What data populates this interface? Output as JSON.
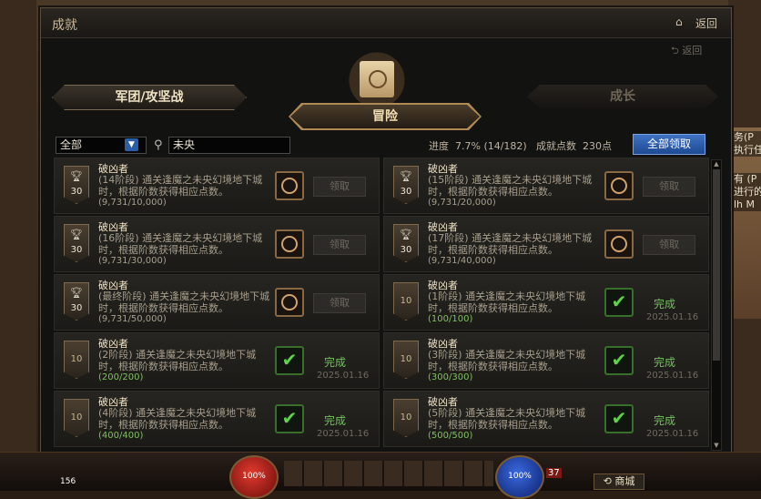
{
  "window": {
    "title": "成就",
    "back_top": "返回",
    "back_sub": "返回"
  },
  "tabs": {
    "left": "军团/攻坚战",
    "center": "冒险",
    "right": "成长"
  },
  "toolbar": {
    "filter_value": "全部",
    "search_value": "未央",
    "progress_label": "进度",
    "progress_value": "7.7% (14/182)",
    "points_label": "成就点数",
    "points_value": "230点",
    "claim_all_label": "全部领取"
  },
  "achievements": [
    {
      "title": "破凶者",
      "desc": "(14阶段) 通关逢魔之未央幻境地下城时，根据阶数获得相应点数。",
      "progress": "(9,731/10,000)",
      "badge": "30",
      "status": "claim",
      "button": "领取"
    },
    {
      "title": "破凶者",
      "desc": "(15阶段) 通关逢魔之未央幻境地下城时，根据阶数获得相应点数。",
      "progress": "(9,731/20,000)",
      "badge": "30",
      "status": "claim",
      "button": "领取"
    },
    {
      "title": "破凶者",
      "desc": "(16阶段) 通关逢魔之未央幻境地下城时，根据阶数获得相应点数。",
      "progress": "(9,731/30,000)",
      "badge": "30",
      "status": "claim",
      "button": "领取"
    },
    {
      "title": "破凶者",
      "desc": "(17阶段) 通关逢魔之未央幻境地下城时，根据阶数获得相应点数。",
      "progress": "(9,731/40,000)",
      "badge": "30",
      "status": "claim",
      "button": "领取"
    },
    {
      "title": "破凶者",
      "desc": "(最终阶段) 通关逢魔之未央幻境地下城时，根据阶数获得相应点数。",
      "progress": "(9,731/50,000)",
      "badge": "30",
      "status": "claim",
      "button": "领取"
    },
    {
      "title": "破凶者",
      "desc": "(1阶段) 通关逢魔之未央幻境地下城时，根据阶数获得相应点数。",
      "progress": "(100/100)",
      "badge": "10",
      "status": "done",
      "done": "完成",
      "date": "2025.01.16"
    },
    {
      "title": "破凶者",
      "desc": "(2阶段) 通关逢魔之未央幻境地下城时，根据阶数获得相应点数。",
      "progress": "(200/200)",
      "badge": "10",
      "status": "done",
      "done": "完成",
      "date": "2025.01.16"
    },
    {
      "title": "破凶者",
      "desc": "(3阶段) 通关逢魔之未央幻境地下城时，根据阶数获得相应点数。",
      "progress": "(300/300)",
      "badge": "10",
      "status": "done",
      "done": "完成",
      "date": "2025.01.16"
    },
    {
      "title": "破凶者",
      "desc": "(4阶段) 通关逢魔之未央幻境地下城时，根据阶数获得相应点数。",
      "progress": "(400/400)",
      "badge": "10",
      "status": "done",
      "done": "完成",
      "date": "2025.01.16"
    },
    {
      "title": "破凶者",
      "desc": "(5阶段) 通关逢魔之未央幻境地下城时，根据阶数获得相应点数。",
      "progress": "(500/500)",
      "badge": "10",
      "status": "done",
      "done": "完成",
      "date": "2025.01.16"
    }
  ],
  "hud": {
    "hp": "100%",
    "mp": "100%",
    "level": "37",
    "shop": "商城",
    "item_count": "156"
  },
  "side_chat": [
    "务(P",
    "执行任",
    "有 (P",
    "进行的",
    "lh M"
  ]
}
